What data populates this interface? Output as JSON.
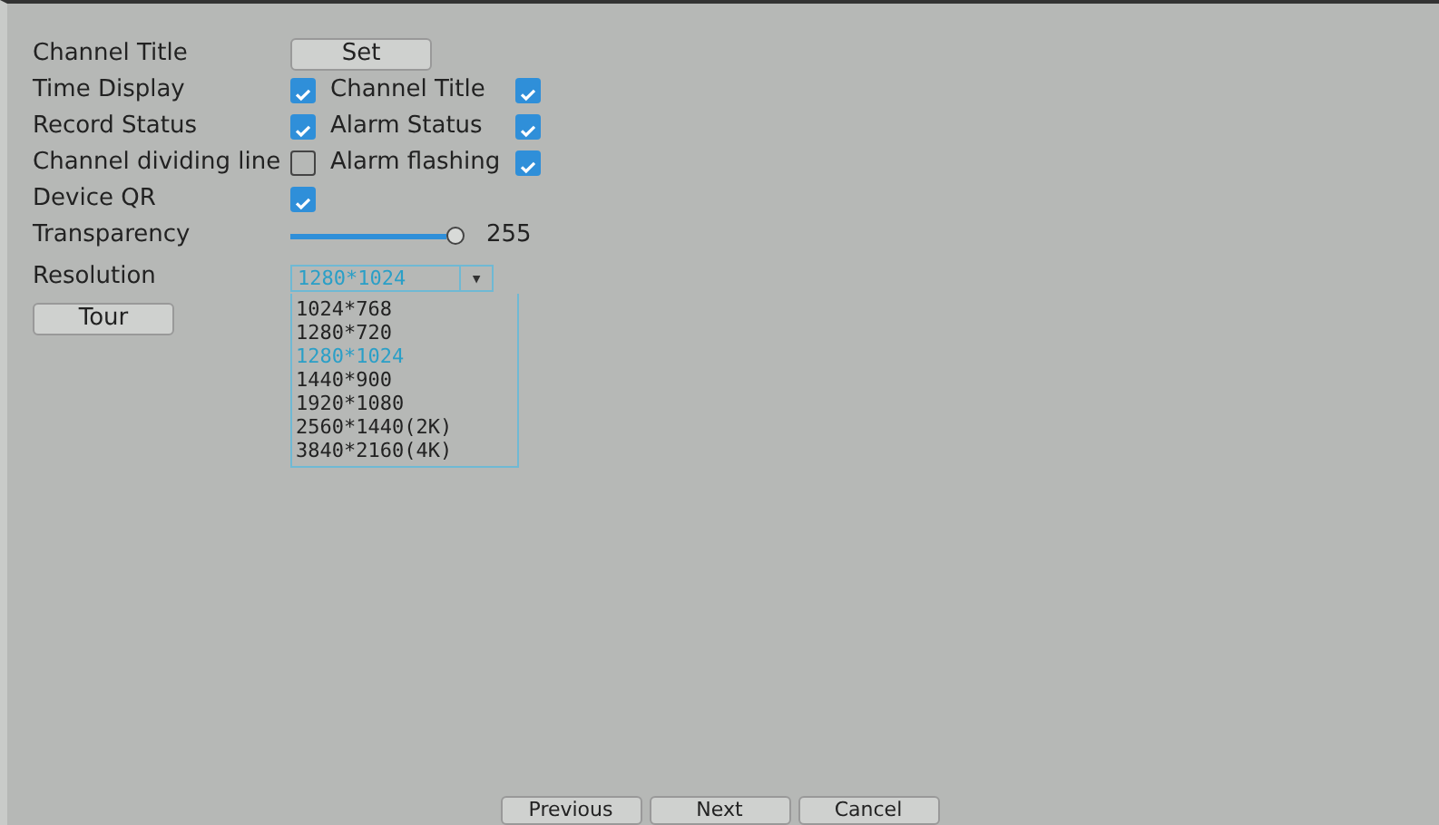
{
  "rows": [
    {
      "kind": "button",
      "label": "Channel Title",
      "button": "Set"
    },
    {
      "kind": "checks",
      "label": "Time Display",
      "checked": true,
      "label2": "Channel Title",
      "checked2": true
    },
    {
      "kind": "checks",
      "label": "Record Status",
      "checked": true,
      "label2": "Alarm Status",
      "checked2": true
    },
    {
      "kind": "checks",
      "label": "Channel dividing line",
      "checked": false,
      "label2": "Alarm flashing",
      "checked2": true
    },
    {
      "kind": "check",
      "label": "Device QR",
      "checked": true
    },
    {
      "kind": "slider",
      "label": "Transparency",
      "level": 1,
      "reading": "255"
    },
    {
      "kind": "dropdown",
      "label": "Resolution",
      "value": "1280*1024",
      "arrow": "▾",
      "options": [
        {
          "label": "1024*768",
          "selected": false
        },
        {
          "label": "1280*720",
          "selected": false
        },
        {
          "label": "1280*1024",
          "selected": true
        },
        {
          "label": "1440*900",
          "selected": false
        },
        {
          "label": "1920*1080",
          "selected": false
        },
        {
          "label": "2560*1440(2K)",
          "selected": false
        },
        {
          "label": "3840*2160(4K)",
          "selected": false
        }
      ]
    }
  ],
  "tour_button": "Tour",
  "footer_buttons": [
    "Previous",
    "Next",
    "Cancel"
  ]
}
